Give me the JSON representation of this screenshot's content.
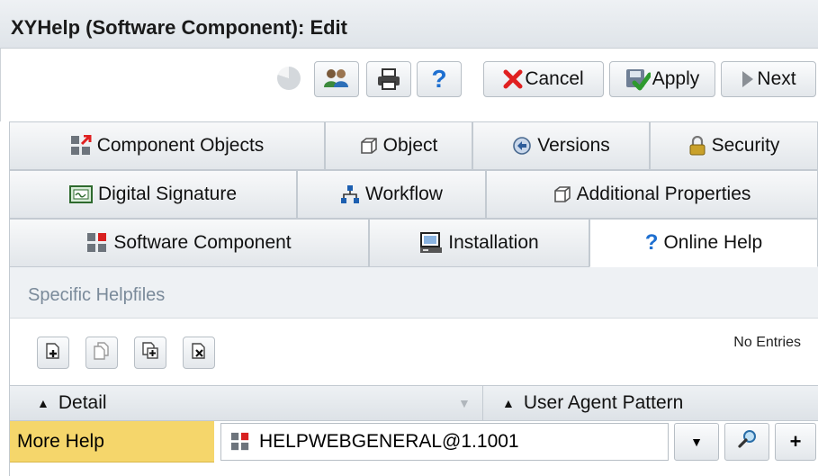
{
  "window": {
    "title": "XYHelp (Software Component): Edit"
  },
  "toolbar": {
    "cancel_label": "Cancel",
    "apply_label": "Apply",
    "next_label": "Next"
  },
  "tabs": {
    "row1": [
      "Component Objects",
      "Object",
      "Versions",
      "Security"
    ],
    "row2": [
      "Digital Signature",
      "Workflow",
      "Additional Properties"
    ],
    "row3": [
      "Software Component",
      "Installation",
      "Online Help"
    ],
    "active": "Online Help"
  },
  "panel": {
    "section_title": "Specific Helpfiles",
    "entries_status": "No Entries",
    "columns": [
      "Detail",
      "User Agent Pattern"
    ],
    "rows": [
      {
        "label": "More Help",
        "value": "HELPWEBGENERAL@1.1001"
      }
    ]
  },
  "colors": {
    "cancel_x": "#e02020",
    "apply_check": "#2e9a2e",
    "help_blue": "#1e6fd0",
    "selected_row": "#f5d66b"
  }
}
